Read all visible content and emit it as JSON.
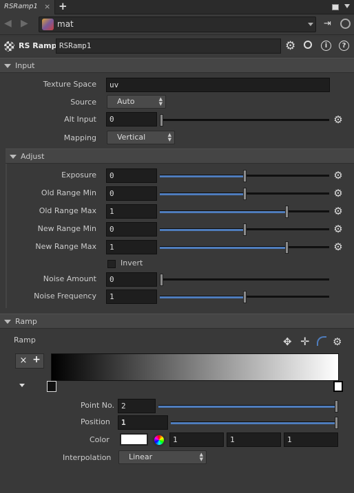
{
  "tabbar": {
    "tab_label": "RSRamp1",
    "close": "×",
    "add": "+"
  },
  "path": {
    "value": "mat"
  },
  "node": {
    "type": "RS Ramp",
    "name": "RSRamp1"
  },
  "input_section": {
    "title": "Input",
    "texture_space": {
      "label": "Texture Space",
      "value": "uv"
    },
    "source": {
      "label": "Source",
      "value": "Auto"
    },
    "alt_input": {
      "label": "Alt Input",
      "value": "0",
      "level": 0
    },
    "mapping": {
      "label": "Mapping",
      "value": "Vertical"
    }
  },
  "adjust_section": {
    "title": "Adjust",
    "exposure": {
      "label": "Exposure",
      "value": "0",
      "level": 0.5
    },
    "old_range_min": {
      "label": "Old Range Min",
      "value": "0",
      "level": 0.5
    },
    "old_range_max": {
      "label": "Old Range Max",
      "value": "1",
      "level": 0.75
    },
    "new_range_min": {
      "label": "New Range Min",
      "value": "0",
      "level": 0.5
    },
    "new_range_max": {
      "label": "New Range Max",
      "value": "1",
      "level": 0.75
    },
    "invert": {
      "label": "Invert",
      "checked": false
    },
    "noise_amount": {
      "label": "Noise Amount",
      "value": "0",
      "level": 0
    },
    "noise_frequency": {
      "label": "Noise Frequency",
      "value": "1",
      "level": 0.5
    }
  },
  "ramp_section": {
    "title": "Ramp",
    "ramp_label": "Ramp",
    "remove_btn": "×",
    "add_btn": "+",
    "gradient": {
      "from": "#000000",
      "to": "#ffffff"
    },
    "point_no": {
      "label": "Point No.",
      "value": "2",
      "level": 1.0
    },
    "position": {
      "label": "Position",
      "value": "1",
      "level": 1.0
    },
    "color": {
      "label": "Color",
      "r": "1",
      "g": "1",
      "b": "1",
      "swatch": "#ffffff"
    },
    "interpolation": {
      "label": "Interpolation",
      "value": "Linear"
    }
  },
  "colors": {
    "accent": "#4f7dbd",
    "panel": "#393939",
    "header": "#454545"
  }
}
